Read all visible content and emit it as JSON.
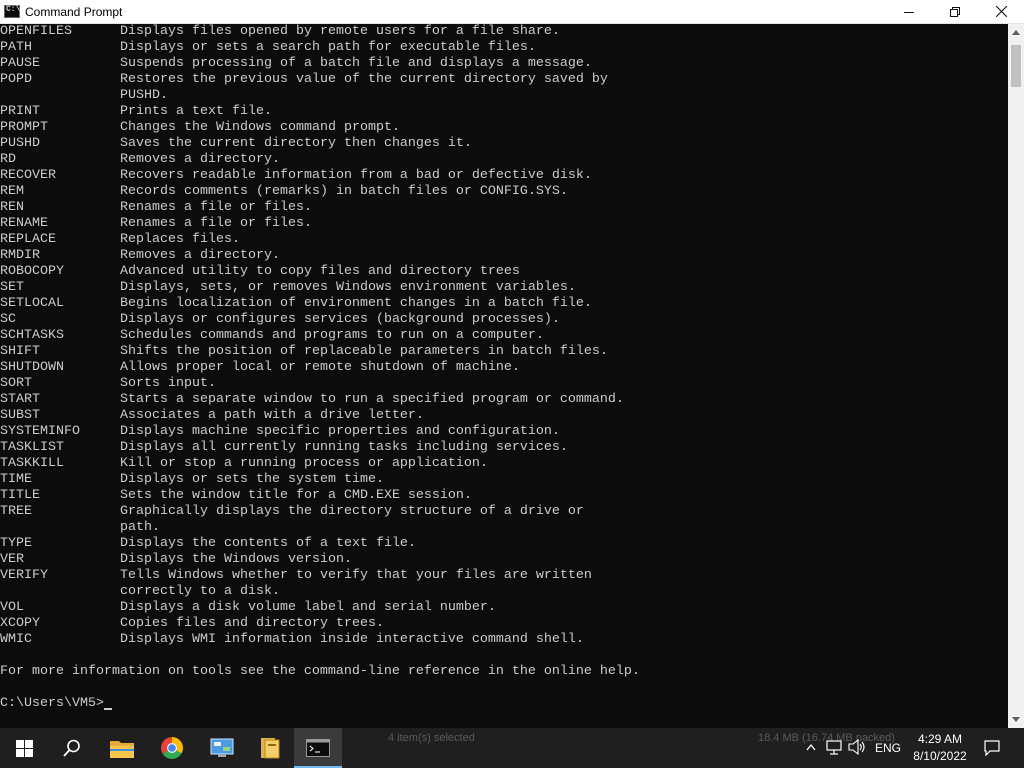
{
  "window": {
    "title": "Command Prompt",
    "icon_label": "C:\\",
    "minimize": "minimize-icon",
    "maximize": "maximize-icon",
    "close": "close-icon"
  },
  "console": {
    "entries": [
      {
        "cmd": "OPENFILES",
        "desc": "Displays files opened by remote users for a file share."
      },
      {
        "cmd": "PATH",
        "desc": "Displays or sets a search path for executable files."
      },
      {
        "cmd": "PAUSE",
        "desc": "Suspends processing of a batch file and displays a message."
      },
      {
        "cmd": "POPD",
        "desc": "Restores the previous value of the current directory saved by"
      },
      {
        "cmd": "",
        "desc": "PUSHD."
      },
      {
        "cmd": "PRINT",
        "desc": "Prints a text file."
      },
      {
        "cmd": "PROMPT",
        "desc": "Changes the Windows command prompt."
      },
      {
        "cmd": "PUSHD",
        "desc": "Saves the current directory then changes it."
      },
      {
        "cmd": "RD",
        "desc": "Removes a directory."
      },
      {
        "cmd": "RECOVER",
        "desc": "Recovers readable information from a bad or defective disk."
      },
      {
        "cmd": "REM",
        "desc": "Records comments (remarks) in batch files or CONFIG.SYS."
      },
      {
        "cmd": "REN",
        "desc": "Renames a file or files."
      },
      {
        "cmd": "RENAME",
        "desc": "Renames a file or files."
      },
      {
        "cmd": "REPLACE",
        "desc": "Replaces files."
      },
      {
        "cmd": "RMDIR",
        "desc": "Removes a directory."
      },
      {
        "cmd": "ROBOCOPY",
        "desc": "Advanced utility to copy files and directory trees"
      },
      {
        "cmd": "SET",
        "desc": "Displays, sets, or removes Windows environment variables."
      },
      {
        "cmd": "SETLOCAL",
        "desc": "Begins localization of environment changes in a batch file."
      },
      {
        "cmd": "SC",
        "desc": "Displays or configures services (background processes)."
      },
      {
        "cmd": "SCHTASKS",
        "desc": "Schedules commands and programs to run on a computer."
      },
      {
        "cmd": "SHIFT",
        "desc": "Shifts the position of replaceable parameters in batch files."
      },
      {
        "cmd": "SHUTDOWN",
        "desc": "Allows proper local or remote shutdown of machine."
      },
      {
        "cmd": "SORT",
        "desc": "Sorts input."
      },
      {
        "cmd": "START",
        "desc": "Starts a separate window to run a specified program or command."
      },
      {
        "cmd": "SUBST",
        "desc": "Associates a path with a drive letter."
      },
      {
        "cmd": "SYSTEMINFO",
        "desc": "Displays machine specific properties and configuration."
      },
      {
        "cmd": "TASKLIST",
        "desc": "Displays all currently running tasks including services."
      },
      {
        "cmd": "TASKKILL",
        "desc": "Kill or stop a running process or application."
      },
      {
        "cmd": "TIME",
        "desc": "Displays or sets the system time."
      },
      {
        "cmd": "TITLE",
        "desc": "Sets the window title for a CMD.EXE session."
      },
      {
        "cmd": "TREE",
        "desc": "Graphically displays the directory structure of a drive or"
      },
      {
        "cmd": "",
        "desc": "path."
      },
      {
        "cmd": "TYPE",
        "desc": "Displays the contents of a text file."
      },
      {
        "cmd": "VER",
        "desc": "Displays the Windows version."
      },
      {
        "cmd": "VERIFY",
        "desc": "Tells Windows whether to verify that your files are written"
      },
      {
        "cmd": "",
        "desc": "correctly to a disk."
      },
      {
        "cmd": "VOL",
        "desc": "Displays a disk volume label and serial number."
      },
      {
        "cmd": "XCOPY",
        "desc": "Copies files and directory trees."
      },
      {
        "cmd": "WMIC",
        "desc": "Displays WMI information inside interactive command shell."
      }
    ],
    "footer": "For more information on tools see the command-line reference in the online help.",
    "prompt": "C:\\Users\\VM5>"
  },
  "taskbar": {
    "start": "windows-start-icon",
    "search": "search-icon",
    "apps": [
      "file-explorer-icon",
      "chrome-icon",
      "control-panel-icon",
      "folder-icon",
      "command-prompt-icon"
    ],
    "ghost_status": "4 item(s) selected",
    "ghost_size": "18.4 MB (16.74 MB packed)",
    "language": "ENG",
    "time": "4:29 AM",
    "date": "8/10/2022"
  }
}
